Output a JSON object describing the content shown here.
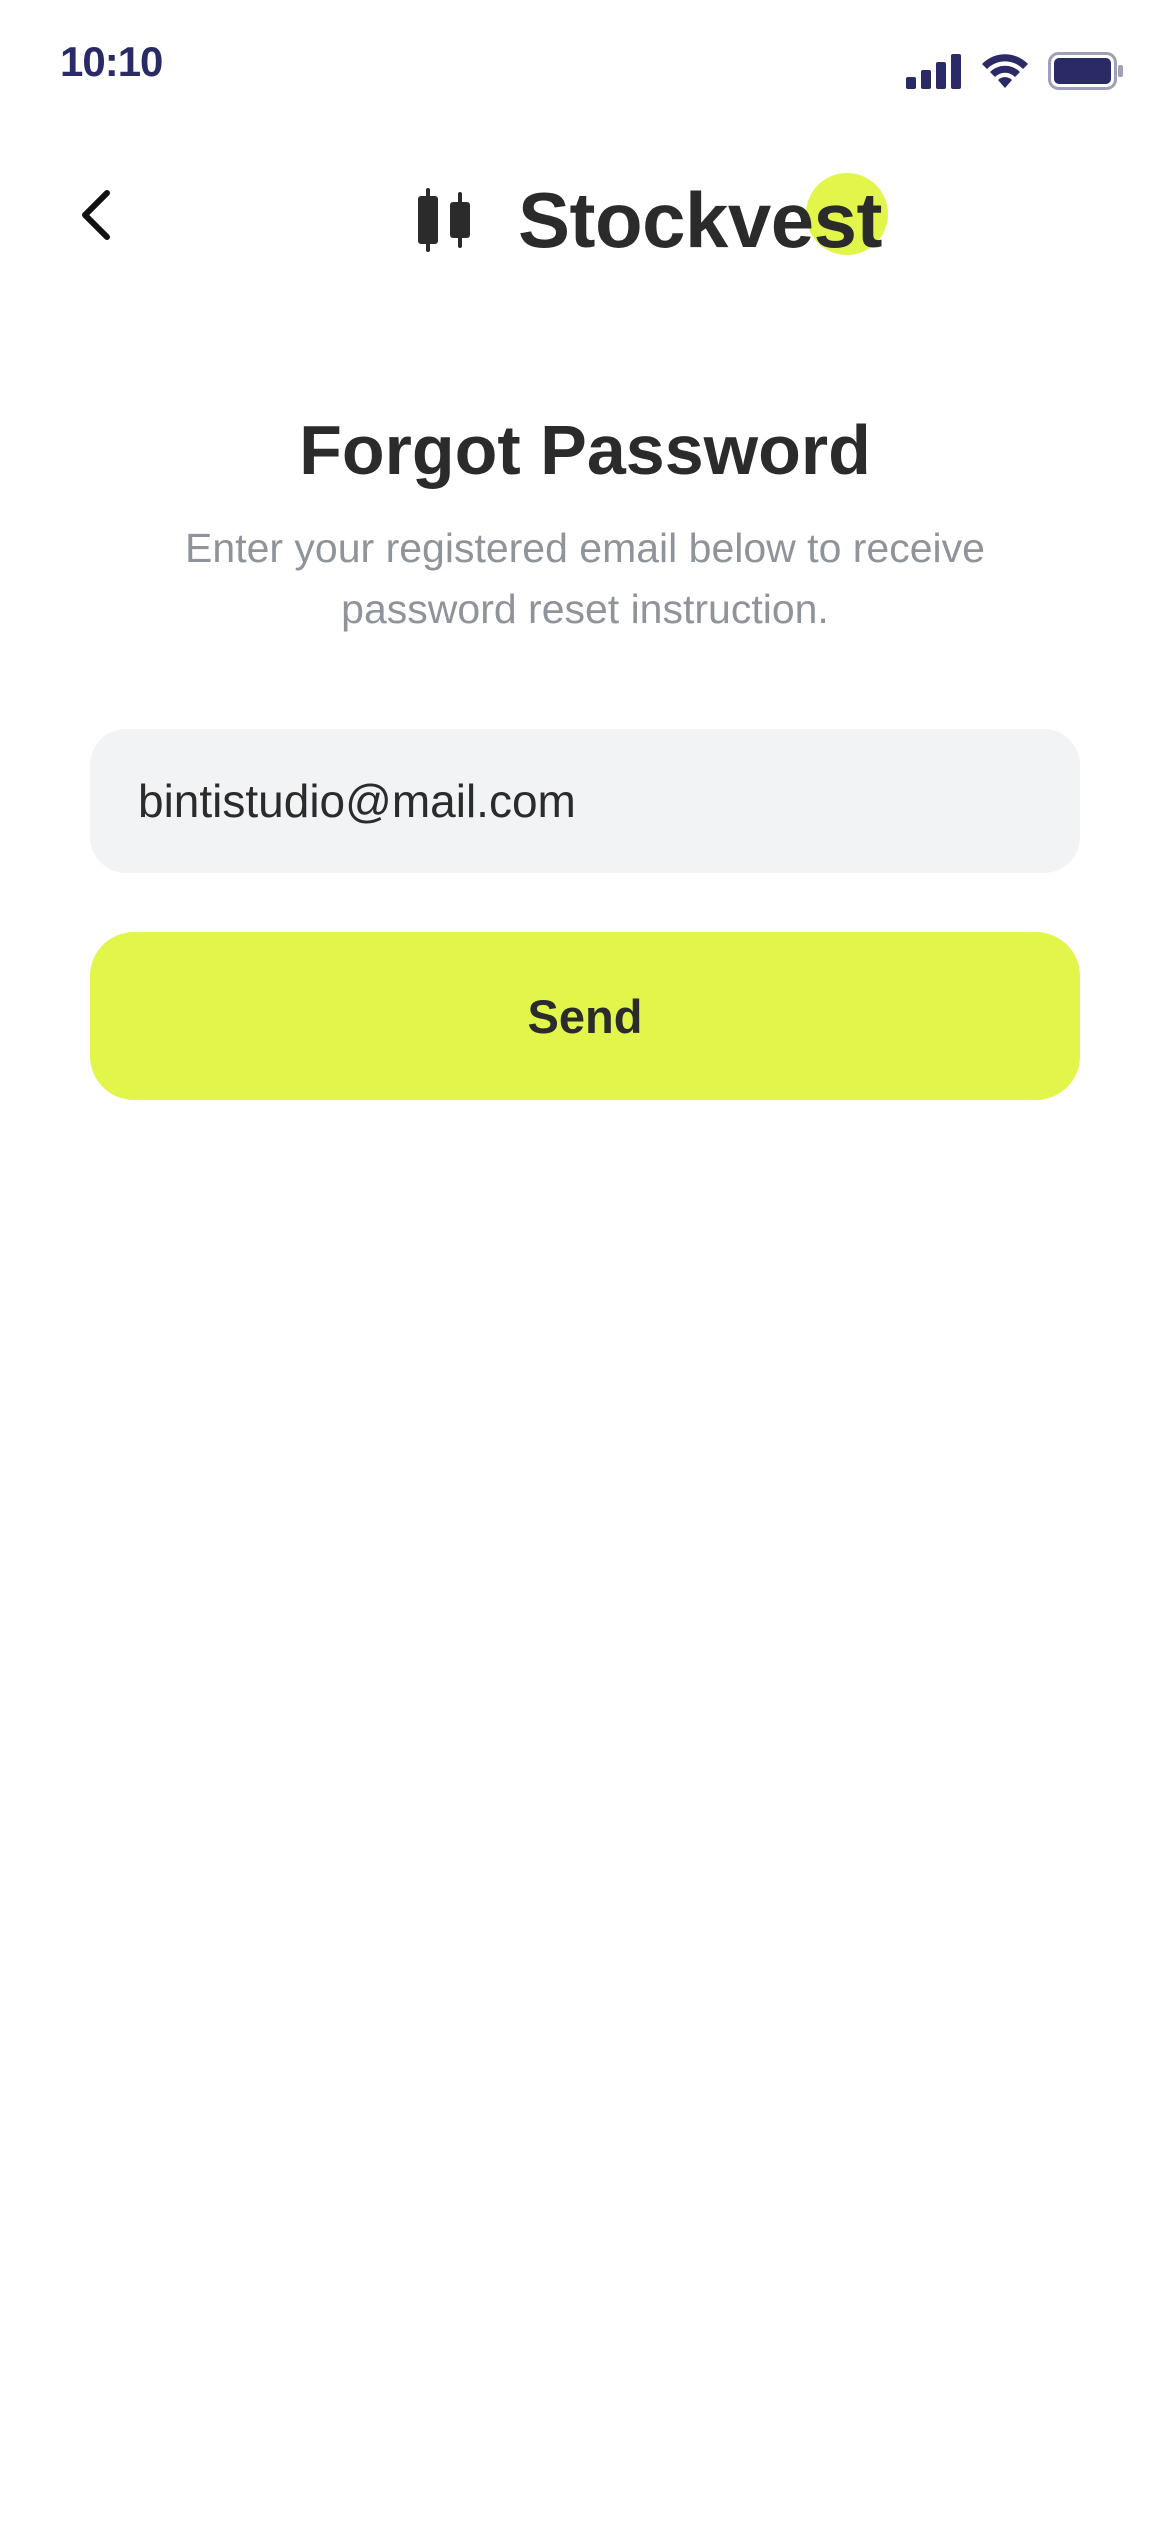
{
  "status_bar": {
    "time": "10:10",
    "icons": [
      "cellular-signal-icon",
      "wifi-icon",
      "battery-icon"
    ],
    "icon_color": "#2a2a66"
  },
  "header": {
    "back_icon": "chevron-left-icon",
    "logo_icon": "candlestick-icon",
    "logo_text": "Stockvest"
  },
  "content": {
    "title": "Forgot Password",
    "subtitle": "Enter your registered email below to receive password reset instruction.",
    "email_value": "bintistudio@mail.com",
    "send_label": "Send"
  },
  "colors": {
    "accent": "#e2f54a",
    "text": "#2b2b2b",
    "muted": "#8f949a",
    "field_bg": "#f2f3f5"
  }
}
